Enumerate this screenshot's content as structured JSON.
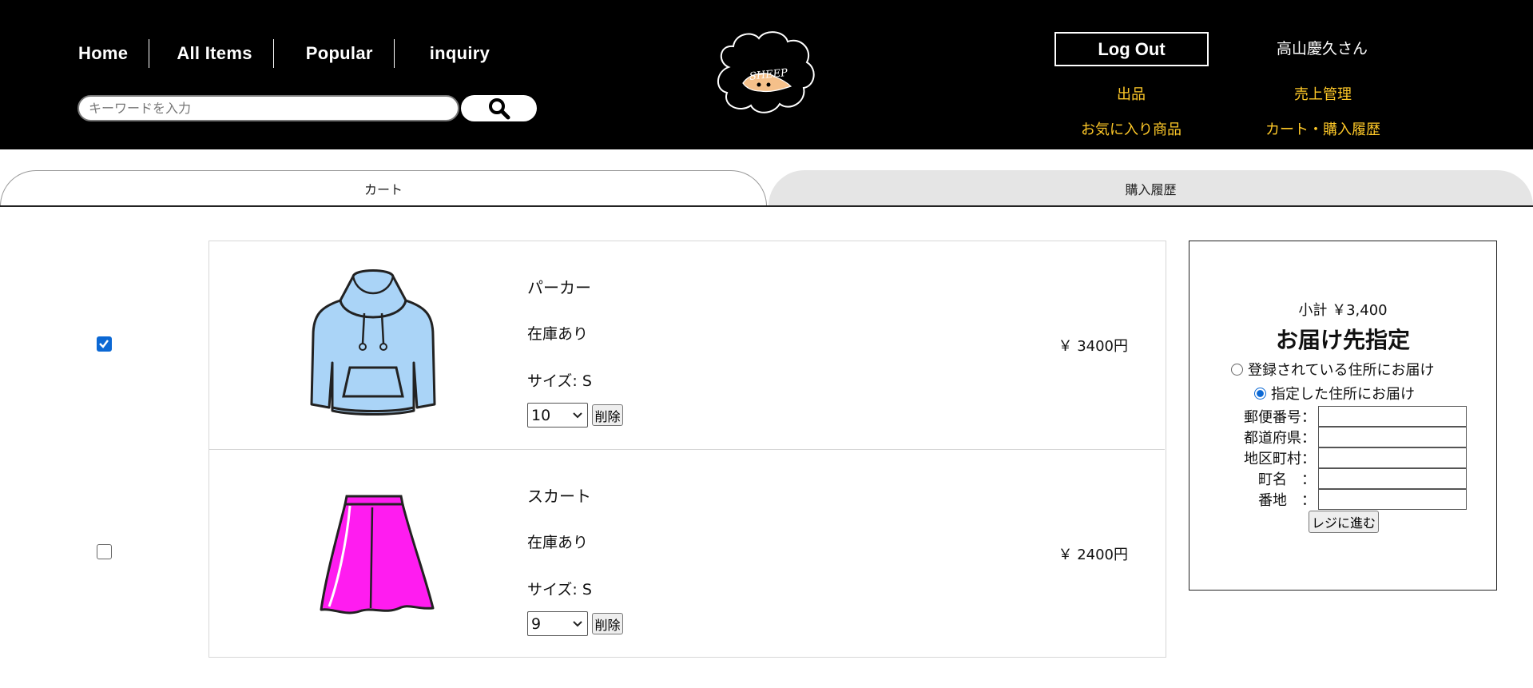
{
  "nav": {
    "items": [
      {
        "label": "Home"
      },
      {
        "label": "All Items"
      },
      {
        "label": "Popular"
      },
      {
        "label": "inquiry"
      }
    ]
  },
  "search": {
    "placeholder": "キーワードを入力",
    "value": "",
    "icon": "search-icon"
  },
  "logo": {
    "text": "SHEEP",
    "icon": "sheep-cloud-logo"
  },
  "account": {
    "logout_label": "Log Out",
    "username": "高山慶久さん",
    "links": {
      "sell": "出品",
      "sales": "売上管理",
      "favorites": "お気に入り商品",
      "cart_history": "カート・購入履歴"
    },
    "link_color": "#ffc928"
  },
  "tabs": {
    "cart": "カート",
    "history": "購入履歴"
  },
  "cart": {
    "items": [
      {
        "name": "パーカー",
        "stock": "在庫あり",
        "size": "サイズ: S",
        "quantity": "10",
        "delete_label": "削除",
        "price": "￥ 3400円",
        "checked": true,
        "icon": "hoodie-icon",
        "color": "#aad4f7"
      },
      {
        "name": "スカート",
        "stock": "在庫あり",
        "size": "サイズ: S",
        "quantity": "9",
        "delete_label": "削除",
        "price": "￥ 2400円",
        "checked": false,
        "icon": "skirt-icon",
        "color": "#ff1cf0"
      }
    ]
  },
  "summary": {
    "subtotal": "小計 ￥3,400",
    "title": "お届け先指定",
    "options": [
      {
        "label": "登録されている住所にお届け",
        "selected": false
      },
      {
        "label": "指定した住所にお届け",
        "selected": true
      }
    ],
    "fields": [
      {
        "label": "郵便番号：",
        "value": ""
      },
      {
        "label": "都道府県：",
        "value": ""
      },
      {
        "label": "地区町村：",
        "value": ""
      },
      {
        "label": "町名　：",
        "value": ""
      },
      {
        "label": "番地　：",
        "value": ""
      }
    ],
    "submit_label": "レジに進む"
  },
  "colors": {
    "header_bg": "#000000",
    "accent_blue": "#0b68d4",
    "tab_inactive": "#e5e5e5"
  }
}
